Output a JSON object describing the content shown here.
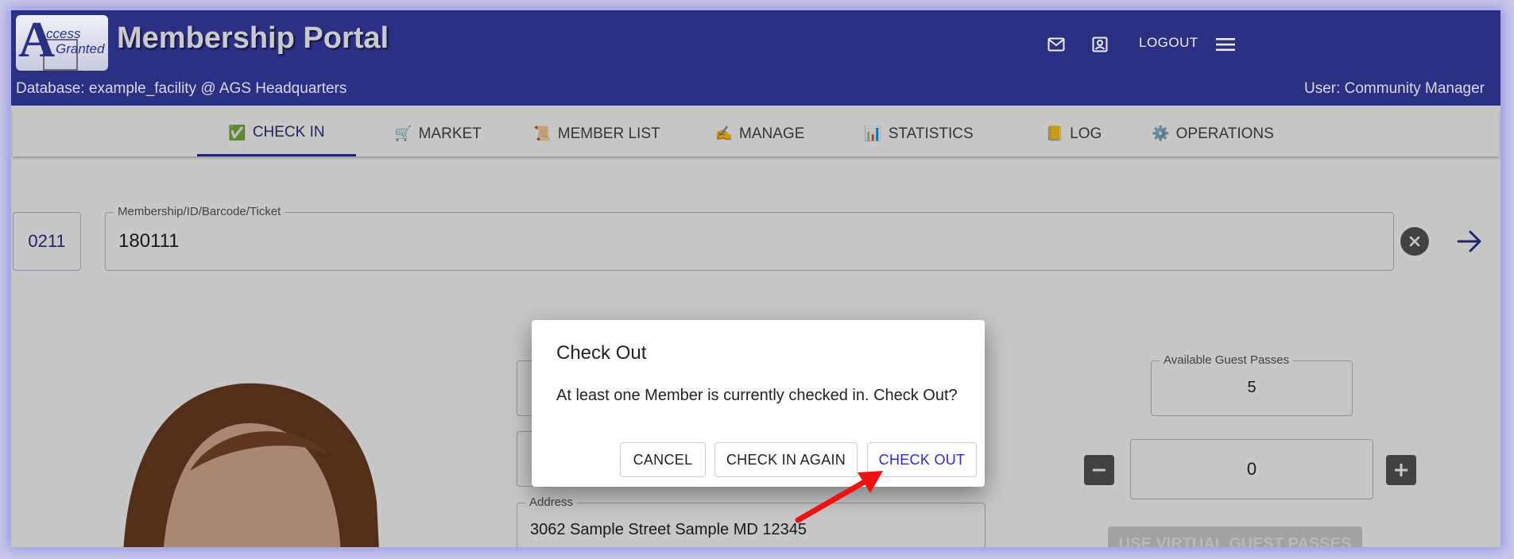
{
  "header": {
    "title": "Membership Portal",
    "logo": {
      "letter": "A",
      "line1": "ccess",
      "line2": "Granted"
    },
    "database": "Database: example_facility @ AGS Headquarters",
    "user": "User: Community Manager",
    "logout_label": "LOGOUT",
    "icons": [
      "mail-icon",
      "account-box-icon",
      "hamburger-menu-icon"
    ]
  },
  "tabs": [
    {
      "emoji": "✅",
      "label": "CHECK IN",
      "active": true
    },
    {
      "emoji": "🛒",
      "label": "MARKET"
    },
    {
      "emoji": "📜",
      "label": "MEMBER LIST"
    },
    {
      "emoji": "✍️",
      "label": "MANAGE"
    },
    {
      "emoji": "📊",
      "label": "STATISTICS"
    },
    {
      "emoji": "📒",
      "label": "LOG"
    },
    {
      "emoji": "⚙️",
      "label": "OPERATIONS"
    }
  ],
  "search": {
    "code": "0211",
    "label": "Membership/ID/Barcode/Ticket",
    "value": "180111"
  },
  "guest_passes": {
    "available_label": "Available Guest Passes",
    "available_value": "5",
    "quantity_value": "0",
    "use_virtual_label": "USE VIRTUAL GUEST PASSES"
  },
  "address": {
    "label": "Address",
    "value": "3062 Sample Street Sample MD 12345"
  },
  "dialog": {
    "title": "Check Out",
    "message": "At least one Member is currently checked in. Check Out?",
    "cancel_label": "CANCEL",
    "check_in_again_label": "CHECK IN AGAIN",
    "check_out_label": "CHECK OUT"
  },
  "colors": {
    "header_bg": "#2a3185",
    "accent": "#2a3185",
    "primary_action": "#2e2ad0",
    "annotation_arrow": "#ee1111"
  }
}
